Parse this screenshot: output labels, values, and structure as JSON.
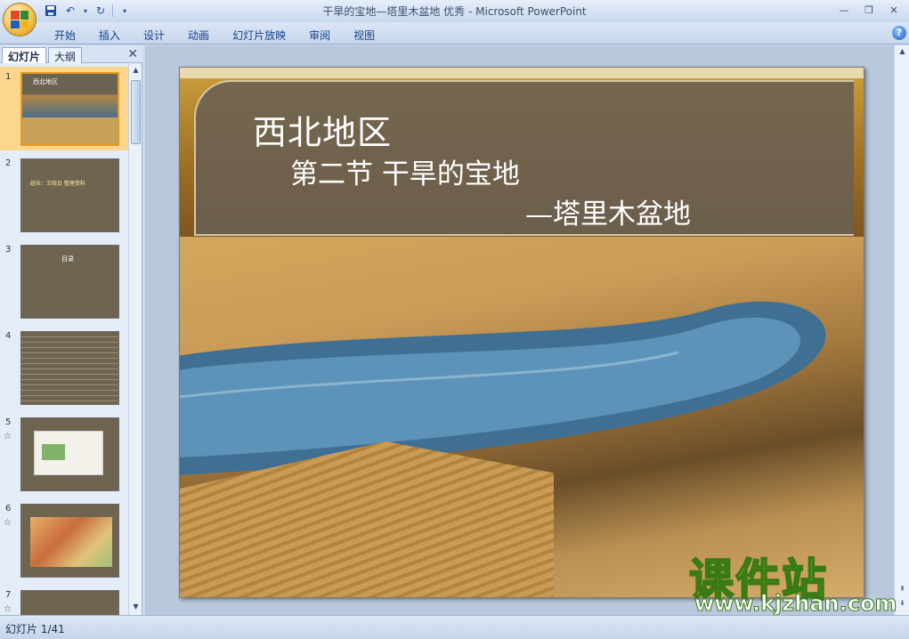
{
  "window": {
    "title": "干旱的宝地—塔里木盆地 优秀 - Microsoft PowerPoint"
  },
  "ribbon": {
    "tabs": [
      "开始",
      "插入",
      "设计",
      "动画",
      "幻灯片放映",
      "审阅",
      "视图"
    ]
  },
  "left_pane": {
    "tabs": [
      "幻灯片",
      "大纲"
    ],
    "thumbnails": [
      {
        "number": "1",
        "caption": "西北地区",
        "selected": true
      },
      {
        "number": "2",
        "caption": "组长：王晓日  整理资料"
      },
      {
        "number": "3",
        "caption": "目录"
      },
      {
        "number": "4",
        "caption": ""
      },
      {
        "number": "5",
        "caption": ""
      },
      {
        "number": "6",
        "caption": ""
      },
      {
        "number": "7",
        "caption": ""
      }
    ]
  },
  "slide": {
    "title": "西北地区",
    "subtitle1": "第二节  干旱的宝地",
    "subtitle2": "—塔里木盆地"
  },
  "watermark": {
    "brand": "课件站",
    "url": "www.kjzhan.com"
  },
  "status": {
    "slide_counter": "幻灯片 1/41"
  }
}
